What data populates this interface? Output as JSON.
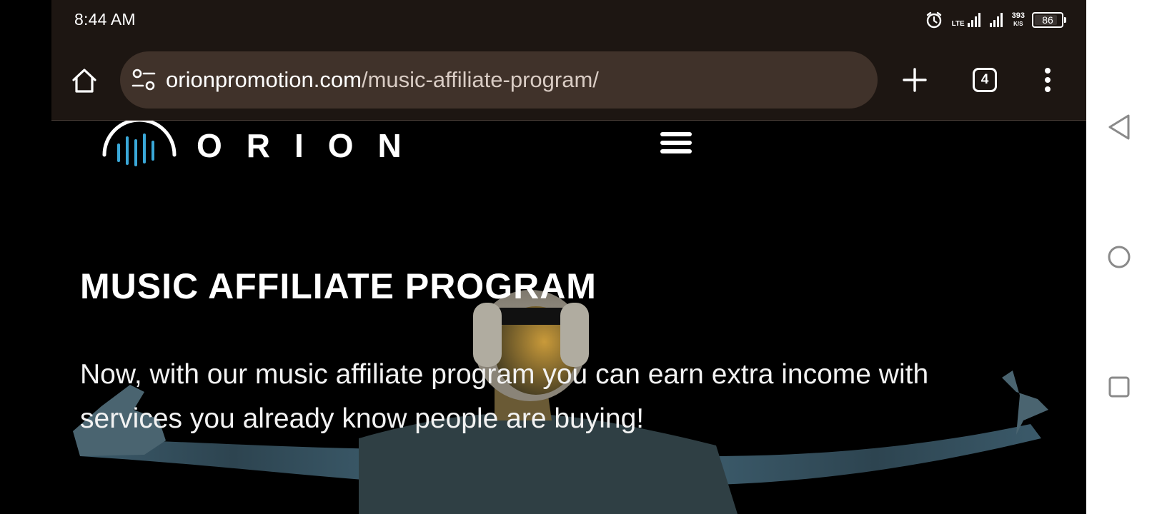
{
  "status_bar": {
    "time": "8:44 AM",
    "network": "LTE",
    "net_speed": "393",
    "net_speed_unit": "K/S",
    "battery": "86",
    "battery_level": 0.86,
    "icons": [
      "alarm-icon",
      "lte-signal-icon",
      "signal-icon",
      "battery-icon"
    ]
  },
  "browser": {
    "url_domain": "orionpromotion.com",
    "url_path": "/music-affiliate-program/",
    "tab_count": "4",
    "icons": [
      "home-icon",
      "site-settings-icon",
      "plus-icon",
      "tabs-icon",
      "more-vert-icon"
    ]
  },
  "site": {
    "brand": "ORION",
    "icons": [
      "orion-logo",
      "hamburger-menu-icon"
    ]
  },
  "hero": {
    "title": "MUSIC AFFILIATE PROGRAM",
    "text": "Now, with our music affiliate program you can earn extra income with services you already know people are buying!"
  },
  "colors": {
    "chrome_bg": "#1d1612",
    "urlbar_bg": "#40322a",
    "page_bg": "#000000",
    "logo_accent": "#3aa8d8"
  },
  "nav_bar": {
    "icons": [
      "back-icon",
      "home-circle-icon",
      "recents-icon"
    ]
  }
}
